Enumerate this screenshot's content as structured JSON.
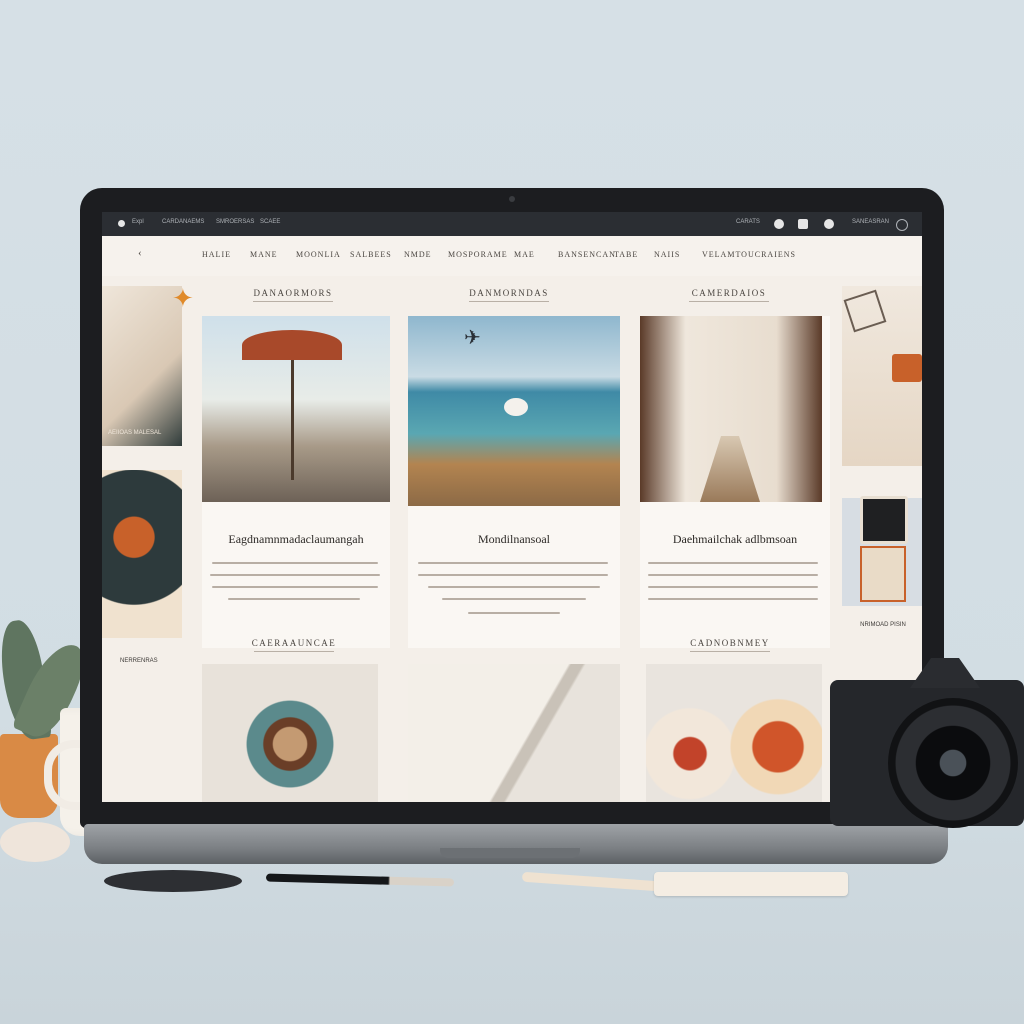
{
  "browser": {
    "tab_labels": [
      "Expl",
      "CARDANAEMS",
      "SMROERSAS",
      "SCAEE"
    ],
    "right_label": "CARATS",
    "account_label": "SANEASRAN"
  },
  "nav": {
    "items": [
      "HALIE",
      "MANE",
      "MOONLIA",
      "SALBEES",
      "NMDE",
      "MOSPORAME",
      "MAE",
      "BANSENCAN",
      "TABE",
      "NAIIS",
      "VELAMTOUCRAIENS"
    ]
  },
  "sections": {
    "left": "DANAORMORS",
    "center": "DANMORNDAS",
    "right": "CAMERDAIOS",
    "bottom_left": "CAERAAUNCAE",
    "bottom_right": "CADNOBNMEY"
  },
  "cards": [
    {
      "title": "Eagdnamnmadaclaumangah"
    },
    {
      "title": "Mondilnansoal"
    },
    {
      "title": "Daehmailchak adlbmsoan"
    }
  ],
  "sidebar": {
    "left_caption": "AEIIOAS MALESAL",
    "left_caption2": "NERRENRAS",
    "right_caption": "NRIMOAD PISIN"
  },
  "colors": {
    "accent": "#c8612a",
    "screen_bg": "#f4efe9",
    "chrome": "#2b2e33"
  }
}
